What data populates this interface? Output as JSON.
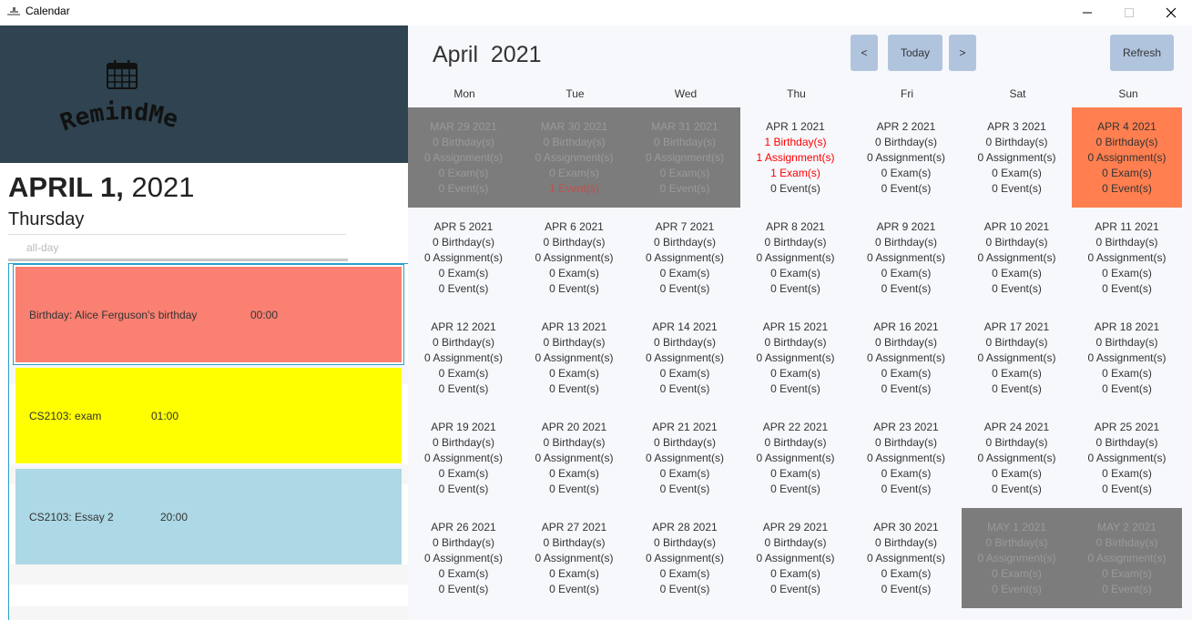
{
  "window": {
    "title": "Calendar",
    "controls": [
      "minimize",
      "maximize",
      "close"
    ]
  },
  "sidebar": {
    "logo_text": "RemindMe",
    "selected_date": {
      "month_day": "APRIL 1,",
      "year": "2021",
      "weekday": "Thursday"
    },
    "allday_label": "all-day",
    "events": [
      {
        "name": "Birthday: Alice Ferguson's birthday",
        "time": "00:00",
        "color": "#fa8072",
        "selected": true
      },
      {
        "name": "CS2103: exam",
        "time": "01:00",
        "color": "#ffff00",
        "selected": false
      },
      {
        "name": "CS2103: Essay 2",
        "time": "20:00",
        "color": "#add8e6",
        "selected": false
      }
    ]
  },
  "calendar": {
    "month_title": "April  2021",
    "buttons": {
      "prev": "<",
      "today": "Today",
      "next": ">",
      "refresh": "Refresh"
    },
    "weekdays": [
      "Mon",
      "Tue",
      "Wed",
      "Thu",
      "Fri",
      "Sat",
      "Sun"
    ],
    "colors": {
      "other_month": "#7c7c7c",
      "today": "#ff7f50",
      "accent_button": "#b0c4de",
      "highlight_count": "#ff0000"
    },
    "days": [
      {
        "date": "MAR 29 2021",
        "birthdays": 0,
        "assignments": 0,
        "exams": 0,
        "events": 0,
        "state": "other"
      },
      {
        "date": "MAR 30 2021",
        "birthdays": 0,
        "assignments": 0,
        "exams": 0,
        "events": 1,
        "state": "other"
      },
      {
        "date": "MAR 31 2021",
        "birthdays": 0,
        "assignments": 0,
        "exams": 0,
        "events": 0,
        "state": "other"
      },
      {
        "date": "APR 1 2021",
        "birthdays": 1,
        "assignments": 1,
        "exams": 1,
        "events": 0,
        "state": "normal"
      },
      {
        "date": "APR 2 2021",
        "birthdays": 0,
        "assignments": 0,
        "exams": 0,
        "events": 0,
        "state": "normal"
      },
      {
        "date": "APR 3 2021",
        "birthdays": 0,
        "assignments": 0,
        "exams": 0,
        "events": 0,
        "state": "normal"
      },
      {
        "date": "APR 4 2021",
        "birthdays": 0,
        "assignments": 0,
        "exams": 0,
        "events": 0,
        "state": "today"
      },
      {
        "date": "APR 5 2021",
        "birthdays": 0,
        "assignments": 0,
        "exams": 0,
        "events": 0,
        "state": "normal"
      },
      {
        "date": "APR 6 2021",
        "birthdays": 0,
        "assignments": 0,
        "exams": 0,
        "events": 0,
        "state": "normal"
      },
      {
        "date": "APR 7 2021",
        "birthdays": 0,
        "assignments": 0,
        "exams": 0,
        "events": 0,
        "state": "normal"
      },
      {
        "date": "APR 8 2021",
        "birthdays": 0,
        "assignments": 0,
        "exams": 0,
        "events": 0,
        "state": "normal"
      },
      {
        "date": "APR 9 2021",
        "birthdays": 0,
        "assignments": 0,
        "exams": 0,
        "events": 0,
        "state": "normal"
      },
      {
        "date": "APR 10 2021",
        "birthdays": 0,
        "assignments": 0,
        "exams": 0,
        "events": 0,
        "state": "normal"
      },
      {
        "date": "APR 11 2021",
        "birthdays": 0,
        "assignments": 0,
        "exams": 0,
        "events": 0,
        "state": "normal"
      },
      {
        "date": "APR 12 2021",
        "birthdays": 0,
        "assignments": 0,
        "exams": 0,
        "events": 0,
        "state": "normal"
      },
      {
        "date": "APR 13 2021",
        "birthdays": 0,
        "assignments": 0,
        "exams": 0,
        "events": 0,
        "state": "normal"
      },
      {
        "date": "APR 14 2021",
        "birthdays": 0,
        "assignments": 0,
        "exams": 0,
        "events": 0,
        "state": "normal"
      },
      {
        "date": "APR 15 2021",
        "birthdays": 0,
        "assignments": 0,
        "exams": 0,
        "events": 0,
        "state": "normal"
      },
      {
        "date": "APR 16 2021",
        "birthdays": 0,
        "assignments": 0,
        "exams": 0,
        "events": 0,
        "state": "normal"
      },
      {
        "date": "APR 17 2021",
        "birthdays": 0,
        "assignments": 0,
        "exams": 0,
        "events": 0,
        "state": "normal"
      },
      {
        "date": "APR 18 2021",
        "birthdays": 0,
        "assignments": 0,
        "exams": 0,
        "events": 0,
        "state": "normal"
      },
      {
        "date": "APR 19 2021",
        "birthdays": 0,
        "assignments": 0,
        "exams": 0,
        "events": 0,
        "state": "normal"
      },
      {
        "date": "APR 20 2021",
        "birthdays": 0,
        "assignments": 0,
        "exams": 0,
        "events": 0,
        "state": "normal"
      },
      {
        "date": "APR 21 2021",
        "birthdays": 0,
        "assignments": 0,
        "exams": 0,
        "events": 0,
        "state": "normal"
      },
      {
        "date": "APR 22 2021",
        "birthdays": 0,
        "assignments": 0,
        "exams": 0,
        "events": 0,
        "state": "normal"
      },
      {
        "date": "APR 23 2021",
        "birthdays": 0,
        "assignments": 0,
        "exams": 0,
        "events": 0,
        "state": "normal"
      },
      {
        "date": "APR 24 2021",
        "birthdays": 0,
        "assignments": 0,
        "exams": 0,
        "events": 0,
        "state": "normal"
      },
      {
        "date": "APR 25 2021",
        "birthdays": 0,
        "assignments": 0,
        "exams": 0,
        "events": 0,
        "state": "normal"
      },
      {
        "date": "APR 26 2021",
        "birthdays": 0,
        "assignments": 0,
        "exams": 0,
        "events": 0,
        "state": "normal"
      },
      {
        "date": "APR 27 2021",
        "birthdays": 0,
        "assignments": 0,
        "exams": 0,
        "events": 0,
        "state": "normal"
      },
      {
        "date": "APR 28 2021",
        "birthdays": 0,
        "assignments": 0,
        "exams": 0,
        "events": 0,
        "state": "normal"
      },
      {
        "date": "APR 29 2021",
        "birthdays": 0,
        "assignments": 0,
        "exams": 0,
        "events": 0,
        "state": "normal"
      },
      {
        "date": "APR 30 2021",
        "birthdays": 0,
        "assignments": 0,
        "exams": 0,
        "events": 0,
        "state": "normal"
      },
      {
        "date": "MAY 1 2021",
        "birthdays": 0,
        "assignments": 0,
        "exams": 0,
        "events": 0,
        "state": "other"
      },
      {
        "date": "MAY 2 2021",
        "birthdays": 0,
        "assignments": 0,
        "exams": 0,
        "events": 0,
        "state": "other"
      }
    ],
    "count_labels": {
      "birthdays": "Birthday(s)",
      "assignments": "Assignment(s)",
      "exams": "Exam(s)",
      "events": "Event(s)"
    }
  }
}
